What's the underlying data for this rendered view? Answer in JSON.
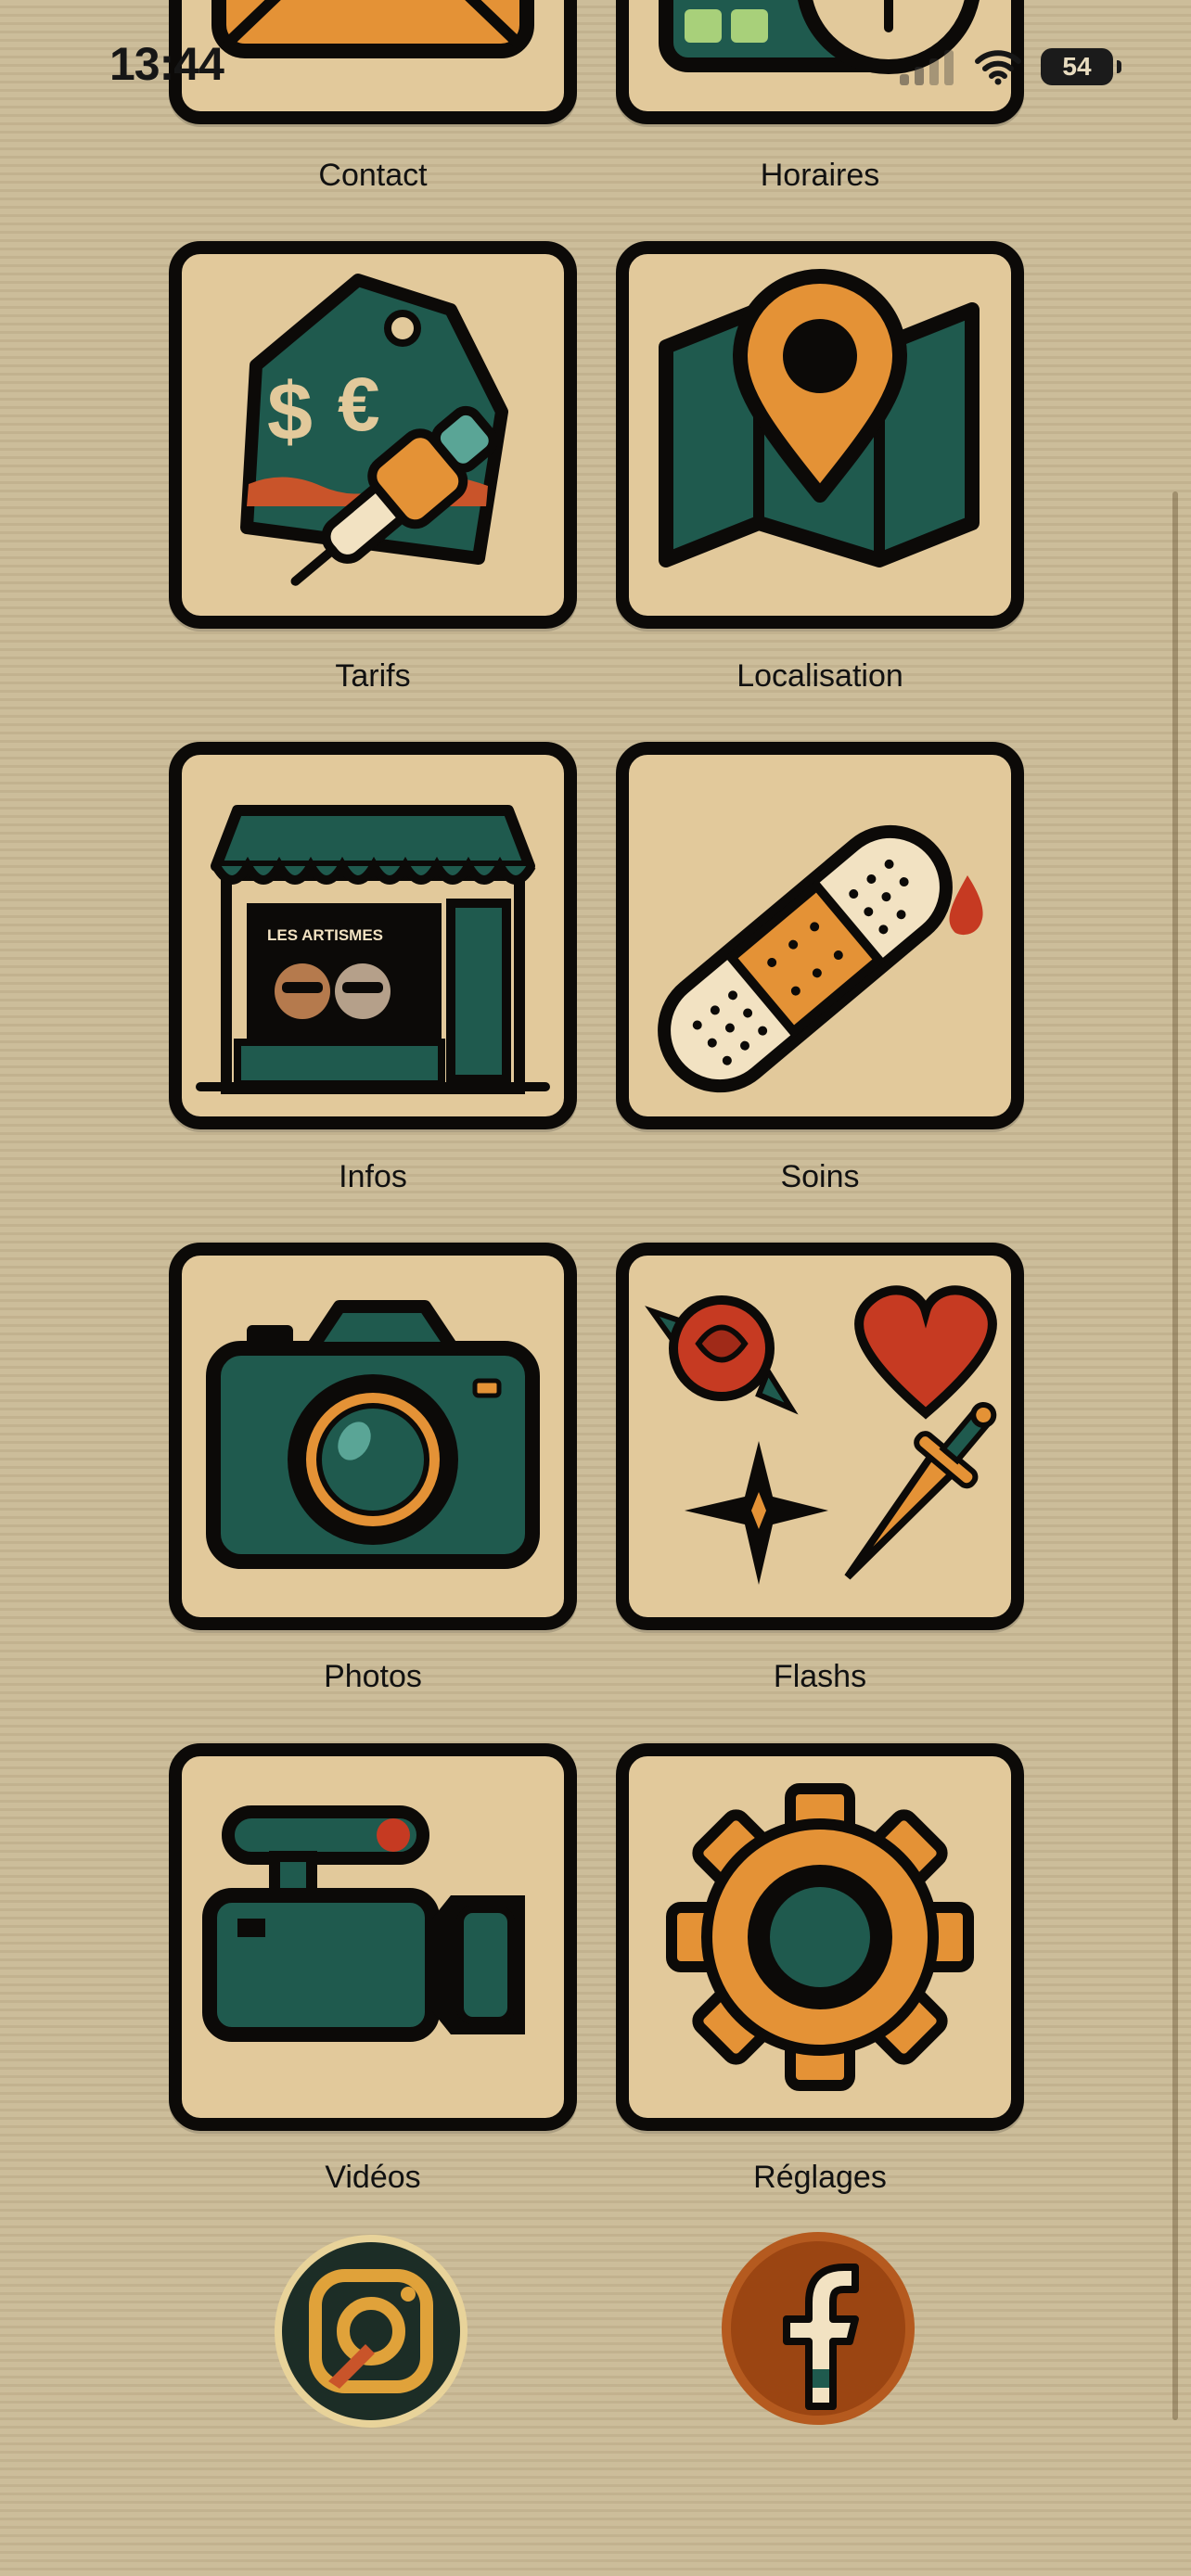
{
  "status_bar": {
    "time": "13:44",
    "battery": "54"
  },
  "tiles": [
    {
      "label": "Contact",
      "icon": "envelope-icon"
    },
    {
      "label": "Horaires",
      "icon": "calendar-clock-icon"
    },
    {
      "label": "Tarifs",
      "icon": "price-tag-tattoo-machine-icon"
    },
    {
      "label": "Localisation",
      "icon": "map-pin-icon"
    },
    {
      "label": "Infos",
      "icon": "tattoo-shop-icon"
    },
    {
      "label": "Soins",
      "icon": "bandage-icon"
    },
    {
      "label": "Photos",
      "icon": "camera-icon"
    },
    {
      "label": "Flashs",
      "icon": "flash-designs-icon"
    },
    {
      "label": "Vidéos",
      "icon": "video-camera-icon"
    },
    {
      "label": "Réglages",
      "icon": "gear-icon"
    }
  ],
  "shop_sign": "LES ARTISMES",
  "social": [
    {
      "name": "Instagram",
      "icon": "instagram-icon"
    },
    {
      "name": "Facebook",
      "icon": "facebook-icon"
    }
  ],
  "colors": {
    "background": "#c9b994",
    "tile": "#e2c99b",
    "teal": "#1f5a4e",
    "orange": "#e49236",
    "red": "#c63a22",
    "outline": "#0c0a08"
  }
}
